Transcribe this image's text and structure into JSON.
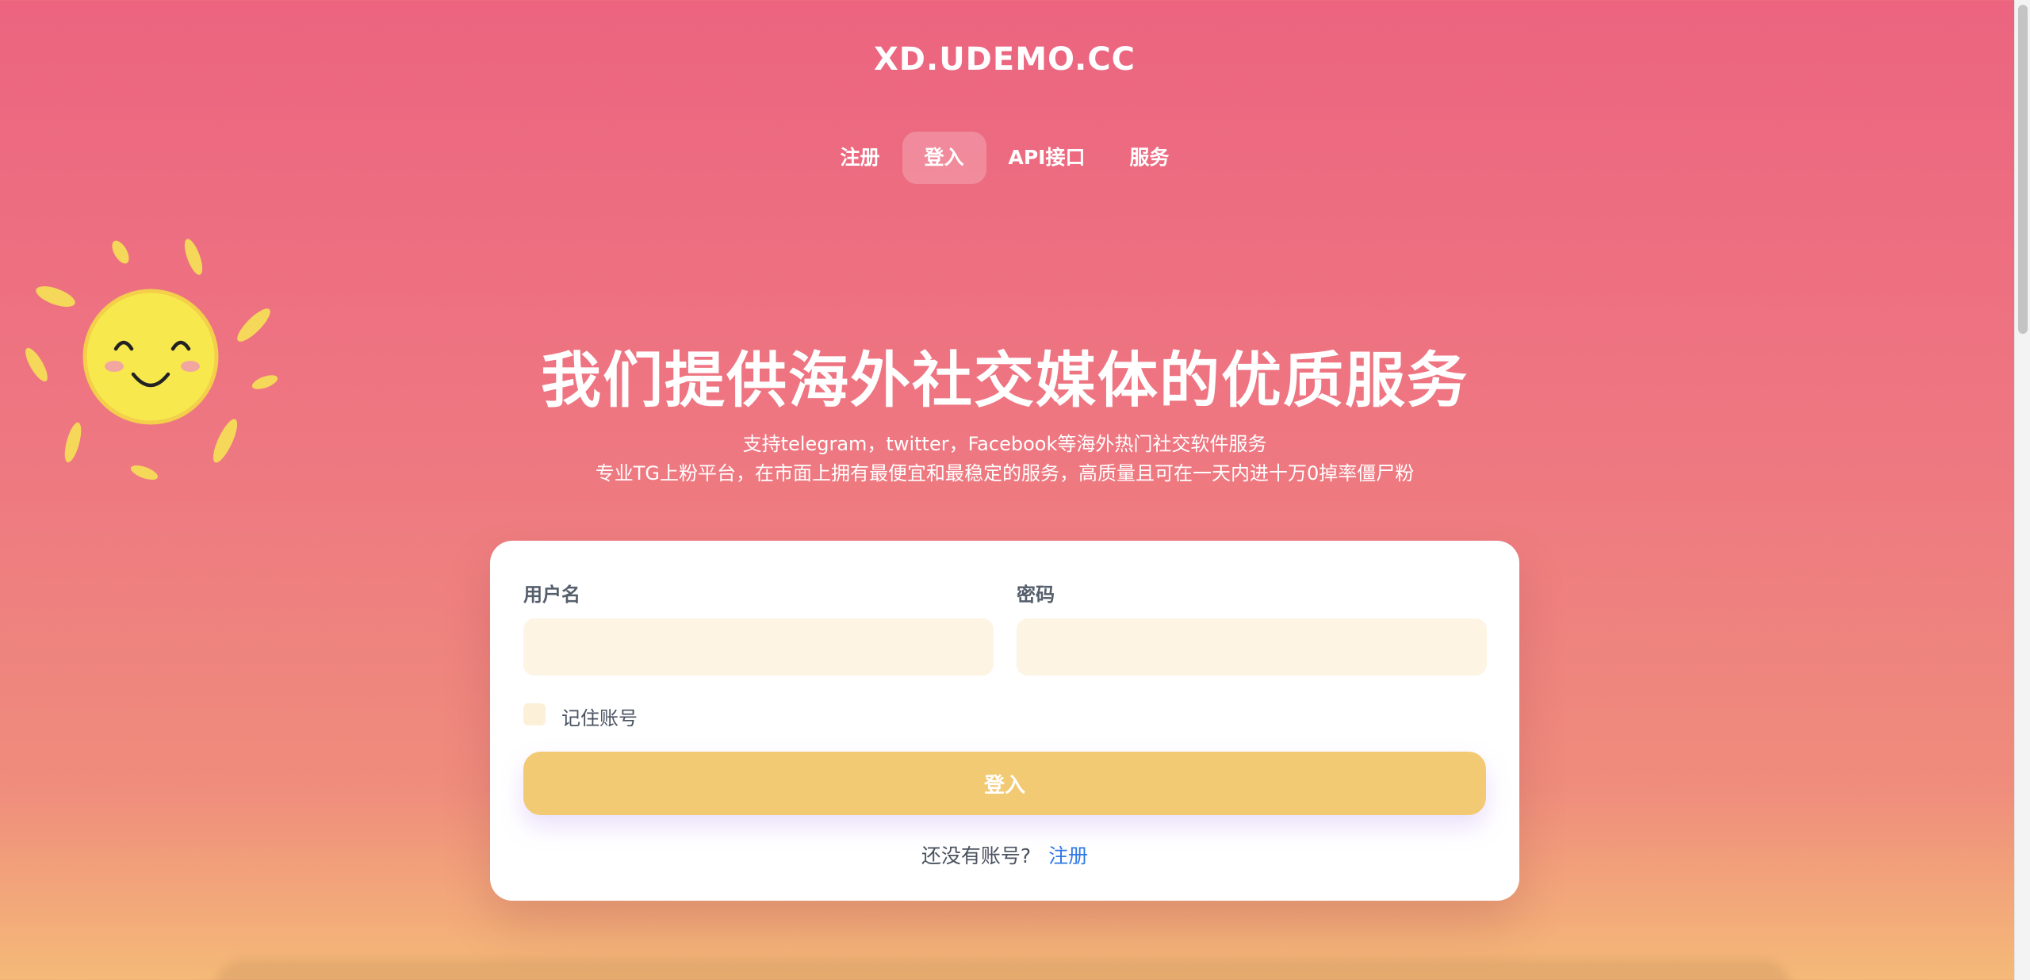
{
  "brand": "XD.UDEMO.CC",
  "nav": {
    "items": [
      {
        "label": "注册",
        "active": false
      },
      {
        "label": "登入",
        "active": true
      },
      {
        "label": "API接口",
        "active": false
      },
      {
        "label": "服务",
        "active": false
      }
    ]
  },
  "hero": {
    "title": "我们提供海外社交媒体的优质服务",
    "subtitle_line1": "支持telegram，twitter，Facebook等海外热门社交软件服务",
    "subtitle_line2": "专业TG上粉平台，在市面上拥有最便宜和最稳定的服务，高质量且可在一天内进十万0掉率僵尸粉"
  },
  "login_form": {
    "username_label": "用户名",
    "username_value": "",
    "password_label": "密码",
    "password_value": "",
    "remember_label": "记住账号",
    "remember_checked": false,
    "submit_label": "登入",
    "no_account_text": "还没有账号?",
    "register_link": "注册"
  },
  "colors": {
    "bg_top": "#ec6480",
    "bg_bottom": "#f5ba78",
    "button": "#f3ca74",
    "input_bg": "#fdf4e3",
    "link": "#2f78e6"
  },
  "icons": {
    "sun": "smiling-sun-icon"
  }
}
